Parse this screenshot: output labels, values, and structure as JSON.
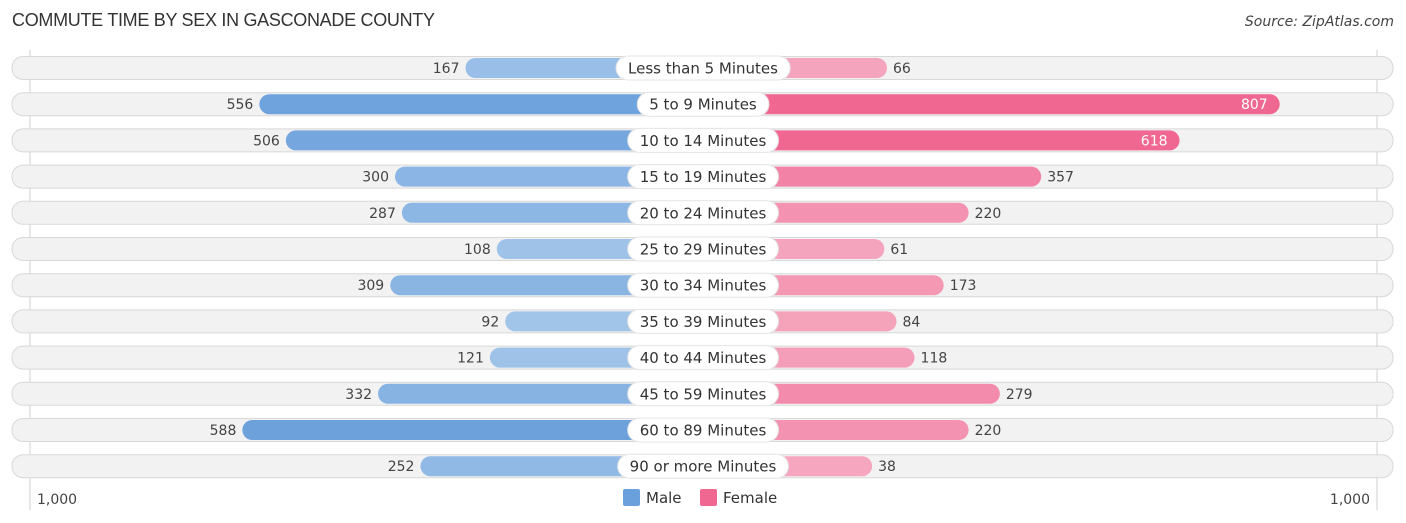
{
  "header": {
    "title": "COMMUTE TIME BY SEX IN GASCONADE COUNTY",
    "source": "Source: ZipAtlas.com"
  },
  "chart_data": {
    "type": "bar",
    "orientation": "horizontal-diverging",
    "title": "COMMUTE TIME BY SEX IN GASCONADE COUNTY",
    "categories": [
      "Less than 5 Minutes",
      "5 to 9 Minutes",
      "10 to 14 Minutes",
      "15 to 19 Minutes",
      "20 to 24 Minutes",
      "25 to 29 Minutes",
      "30 to 34 Minutes",
      "35 to 39 Minutes",
      "40 to 44 Minutes",
      "45 to 59 Minutes",
      "60 to 89 Minutes",
      "90 or more Minutes"
    ],
    "series": [
      {
        "name": "Male",
        "side": "left",
        "color": "#6aa0dc",
        "light_color": "#abcaeb",
        "values": [
          167,
          556,
          506,
          300,
          287,
          108,
          309,
          92,
          121,
          332,
          588,
          252
        ]
      },
      {
        "name": "Female",
        "side": "right",
        "color": "#f06892",
        "light_color": "#f6abc2",
        "values": [
          66,
          807,
          618,
          357,
          220,
          61,
          173,
          84,
          118,
          279,
          220,
          38
        ]
      }
    ],
    "axis": {
      "min_label": "1,000",
      "max_label": "1,000",
      "range": [
        0,
        1000
      ]
    },
    "legend": {
      "position": "bottom-center",
      "items": [
        "Male",
        "Female"
      ]
    },
    "inside_label_threshold": 600
  }
}
